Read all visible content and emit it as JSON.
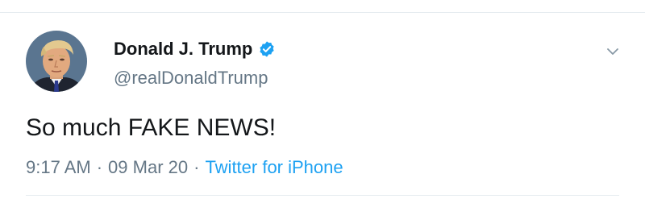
{
  "tweet": {
    "author": {
      "display_name": "Donald J. Trump",
      "handle": "@realDonaldTrump",
      "verified": true,
      "avatar_icon": "profile-photo"
    },
    "text": "So much FAKE NEWS!",
    "time": "9:17 AM",
    "date": "09 Mar 20",
    "separator": "·",
    "source": "Twitter for iPhone",
    "menu_icon": "chevron-down-icon"
  },
  "colors": {
    "text_primary": "#14171a",
    "text_secondary": "#657786",
    "accent": "#1da1f2",
    "divider": "#e6ecf0"
  }
}
